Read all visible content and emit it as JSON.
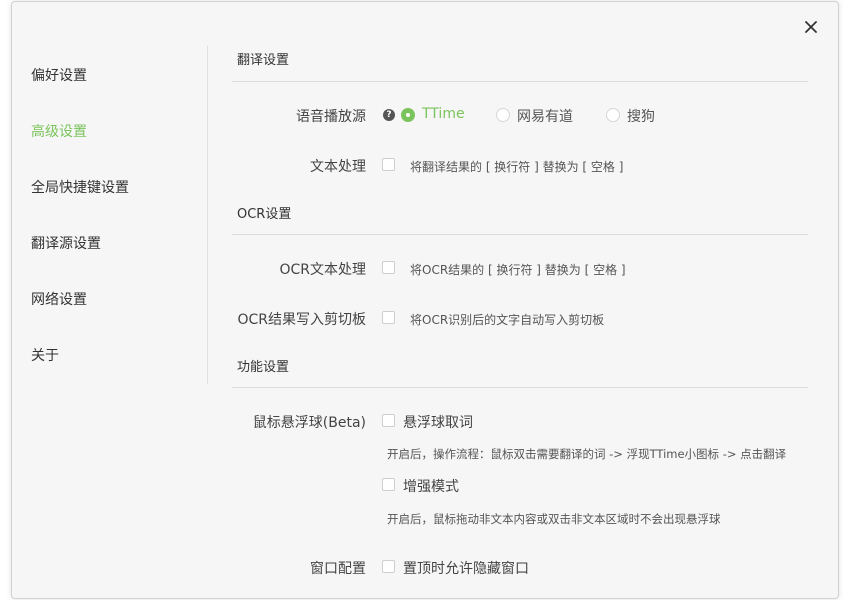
{
  "sidebar": {
    "items": [
      {
        "label": "偏好设置"
      },
      {
        "label": "高级设置"
      },
      {
        "label": "全局快捷键设置"
      },
      {
        "label": "翻译源设置"
      },
      {
        "label": "网络设置"
      },
      {
        "label": "关于"
      }
    ]
  },
  "sections": {
    "translate": {
      "title": "翻译设置",
      "voice_label": "语音播放源",
      "voice_options": [
        {
          "label": "TTime",
          "selected": true
        },
        {
          "label": "网易有道",
          "selected": false
        },
        {
          "label": "搜狗",
          "selected": false
        }
      ],
      "text_label": "文本处理",
      "text_checkbox": "将翻译结果的 [ 换行符 ] 替换为 [ 空格 ]"
    },
    "ocr": {
      "title": "OCR设置",
      "text_label": "OCR文本处理",
      "text_checkbox": "将OCR结果的 [ 换行符 ] 替换为 [ 空格 ]",
      "clip_label": "OCR结果写入剪切板",
      "clip_checkbox": "将OCR识别后的文字自动写入剪切板"
    },
    "feature": {
      "title": "功能设置",
      "hover_label": "鼠标悬浮球(Beta)",
      "hover_checkbox": "悬浮球取词",
      "hover_hint": "开启后，操作流程：鼠标双击需要翻译的词 -> 浮现TTime小图标 -> 点击翻译",
      "enhance_checkbox": "增强模式",
      "enhance_hint": "开启后，鼠标拖动非文本内容或双击非文本区域时不会出现悬浮球",
      "window_label": "窗口配置",
      "window_checkbox": "置顶时允许隐藏窗口"
    }
  },
  "colors": {
    "accent": "#7bc45d"
  }
}
